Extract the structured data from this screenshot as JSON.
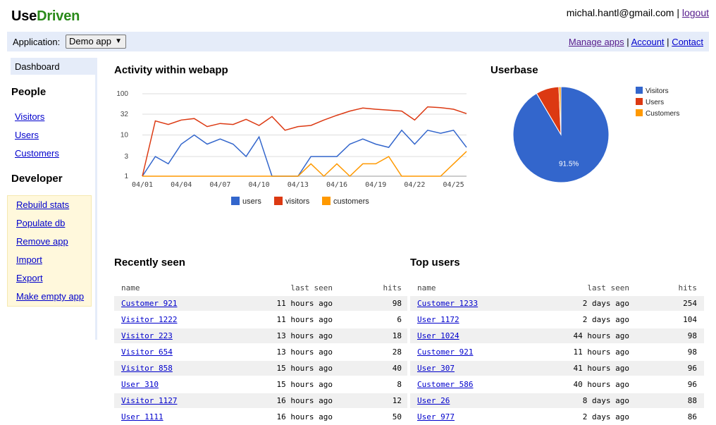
{
  "brand": {
    "part1": "Use",
    "part2": "Driven"
  },
  "user": {
    "email": "michal.hantl@gmail.com",
    "logout": "logout",
    "sep": "|"
  },
  "appbar": {
    "label": "Application:",
    "selected_app": "Demo app",
    "links": [
      "Manage apps",
      "Account",
      "Contact"
    ]
  },
  "sidebar": {
    "dashboard": "Dashboard",
    "people_heading": "People",
    "people_links": [
      "Visitors",
      "Users",
      "Customers"
    ],
    "developer_heading": "Developer",
    "developer_links": [
      "Rebuild stats",
      "Populate db",
      "Remove app",
      "Import",
      "Export",
      "Make empty app"
    ]
  },
  "activity": {
    "title": "Activity within webapp"
  },
  "userbase": {
    "title": "Userbase"
  },
  "chart_data": [
    {
      "type": "line",
      "title": "Activity within webapp",
      "yscale": "log",
      "ylim": [
        1,
        100
      ],
      "yticks": [
        "100",
        "32",
        "10",
        "3",
        "1"
      ],
      "x": [
        "04/01",
        "04/02",
        "04/03",
        "04/04",
        "04/05",
        "04/06",
        "04/07",
        "04/08",
        "04/09",
        "04/10",
        "04/11",
        "04/12",
        "04/13",
        "04/14",
        "04/15",
        "04/16",
        "04/17",
        "04/18",
        "04/19",
        "04/20",
        "04/21",
        "04/22",
        "04/23",
        "04/24",
        "04/25",
        "04/26"
      ],
      "xticks": [
        "04/01",
        "04/04",
        "04/07",
        "04/10",
        "04/13",
        "04/16",
        "04/19",
        "04/22",
        "04/25"
      ],
      "legend_position": "bottom",
      "series": [
        {
          "name": "users",
          "color": "#3366cc",
          "values": [
            1,
            3,
            2,
            6,
            10,
            6,
            8,
            6,
            3,
            9,
            1,
            1,
            1,
            3,
            3,
            3,
            6,
            8,
            6,
            5,
            13,
            6,
            13,
            11,
            13,
            5
          ]
        },
        {
          "name": "visitors",
          "color": "#dc3912",
          "values": [
            1,
            22,
            18,
            23,
            25,
            16,
            19,
            18,
            24,
            17,
            28,
            13,
            16,
            17,
            23,
            30,
            38,
            45,
            42,
            40,
            38,
            23,
            48,
            46,
            42,
            33
          ]
        },
        {
          "name": "customers",
          "color": "#ff9900",
          "values": [
            1,
            1,
            1,
            1,
            1,
            1,
            1,
            1,
            1,
            1,
            1,
            1,
            1,
            2,
            1,
            2,
            1,
            2,
            2,
            3,
            1,
            1,
            1,
            1,
            2,
            4
          ]
        }
      ]
    },
    {
      "type": "pie",
      "title": "Userbase",
      "legend_position": "right",
      "slices": [
        {
          "label": "Visitors",
          "value": 91.5,
          "color": "#3366cc",
          "data_label": "91.5%"
        },
        {
          "label": "Users",
          "value": 7.8,
          "color": "#dc3912",
          "data_label": ""
        },
        {
          "label": "Customers",
          "value": 0.7,
          "color": "#ff9900",
          "data_label": ""
        }
      ]
    }
  ],
  "recently_seen": {
    "title": "Recently seen",
    "headers": [
      "name",
      "last seen",
      "hits"
    ],
    "rows": [
      {
        "name": "Customer 921",
        "last_seen": "11 hours ago",
        "hits": "98"
      },
      {
        "name": "Visitor 1222",
        "last_seen": "11 hours ago",
        "hits": "6"
      },
      {
        "name": "Visitor 223",
        "last_seen": "13 hours ago",
        "hits": "18"
      },
      {
        "name": "Visitor 654",
        "last_seen": "13 hours ago",
        "hits": "28"
      },
      {
        "name": "Visitor 858",
        "last_seen": "15 hours ago",
        "hits": "40"
      },
      {
        "name": "User 310",
        "last_seen": "15 hours ago",
        "hits": "8"
      },
      {
        "name": "Visitor 1127",
        "last_seen": "16 hours ago",
        "hits": "12"
      },
      {
        "name": "User 1111",
        "last_seen": "16 hours ago",
        "hits": "50"
      }
    ]
  },
  "top_users": {
    "title": "Top users",
    "headers": [
      "name",
      "last seen",
      "hits"
    ],
    "rows": [
      {
        "name": "Customer 1233",
        "last_seen": "2 days ago",
        "hits": "254"
      },
      {
        "name": "User 1172",
        "last_seen": "2 days ago",
        "hits": "104"
      },
      {
        "name": "User 1024",
        "last_seen": "44 hours ago",
        "hits": "98"
      },
      {
        "name": "Customer 921",
        "last_seen": "11 hours ago",
        "hits": "98"
      },
      {
        "name": "User 307",
        "last_seen": "41 hours ago",
        "hits": "96"
      },
      {
        "name": "Customer 586",
        "last_seen": "40 hours ago",
        "hits": "96"
      },
      {
        "name": "User 26",
        "last_seen": "8 days ago",
        "hits": "88"
      },
      {
        "name": "User 977",
        "last_seen": "2 days ago",
        "hits": "86"
      }
    ]
  }
}
